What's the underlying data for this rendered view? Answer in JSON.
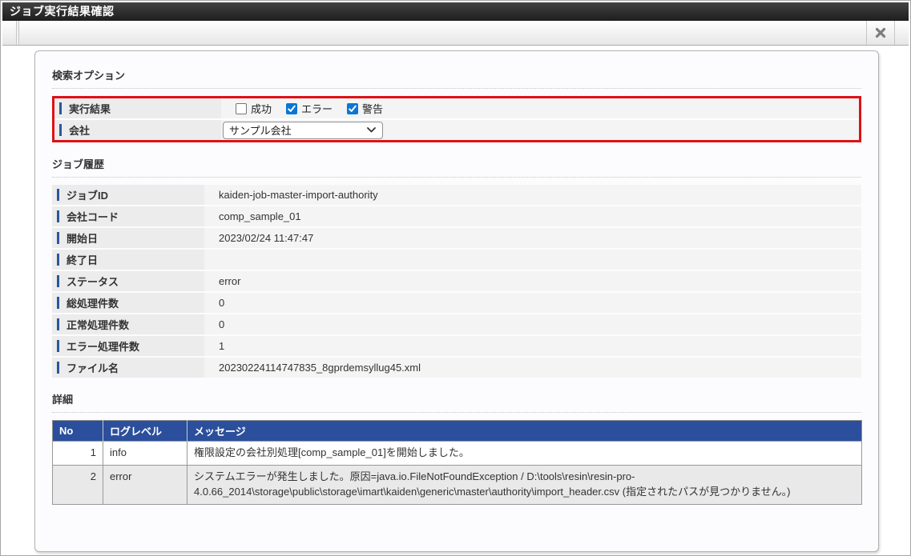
{
  "window": {
    "title": "ジョブ実行結果確認"
  },
  "search": {
    "heading": "検索オプション",
    "highlight_color": "#dd1116",
    "result": {
      "label": "実行結果",
      "options": [
        {
          "key": "success",
          "label": "成功",
          "checked": false
        },
        {
          "key": "error",
          "label": "エラー",
          "checked": true
        },
        {
          "key": "warning",
          "label": "警告",
          "checked": true
        }
      ]
    },
    "company": {
      "label": "会社",
      "selected": "サンプル会社"
    }
  },
  "job_history": {
    "heading": "ジョブ履歴",
    "rows": [
      {
        "label": "ジョブID",
        "value": "kaiden-job-master-import-authority"
      },
      {
        "label": "会社コード",
        "value": "comp_sample_01"
      },
      {
        "label": "開始日",
        "value": "2023/02/24 11:47:47"
      },
      {
        "label": "終了日",
        "value": ""
      },
      {
        "label": "ステータス",
        "value": "error"
      },
      {
        "label": "総処理件数",
        "value": "0"
      },
      {
        "label": "正常処理件数",
        "value": "0"
      },
      {
        "label": "エラー処理件数",
        "value": "1"
      },
      {
        "label": "ファイル名",
        "value": "20230224114747835_8gprdemsyllug45.xml"
      }
    ]
  },
  "details": {
    "heading": "詳細",
    "table": {
      "columns": [
        "No",
        "ログレベル",
        "メッセージ"
      ],
      "rows": [
        {
          "no": "1",
          "level": "info",
          "message": "権限設定の会社別処理[comp_sample_01]を開始しました。"
        },
        {
          "no": "2",
          "level": "error",
          "message": "システムエラーが発生しました。原因=java.io.FileNotFoundException / D:\\tools\\resin\\resin-pro-4.0.66_2014\\storage\\public\\storage\\imart\\kaiden\\generic\\master\\authority\\import_header.csv (指定されたパスが見つかりません。)"
        }
      ]
    }
  },
  "colors": {
    "header_blue": "#2b4f9c",
    "label_bar_blue": "#2a579e",
    "checkbox_blue": "#0b76d6",
    "highlight_red": "#dd1116",
    "titlebar_black": "#1e1e1e"
  }
}
